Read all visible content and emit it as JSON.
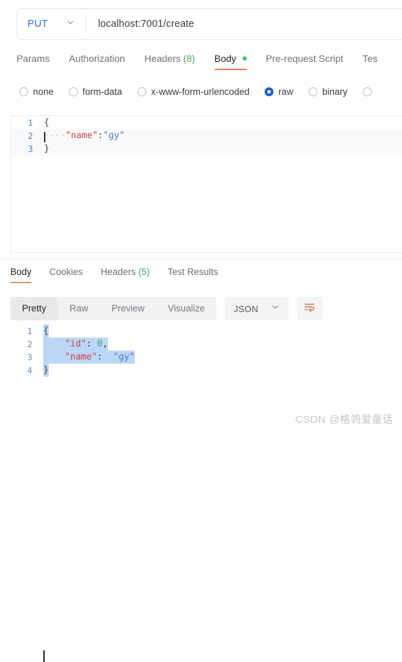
{
  "request": {
    "method": "PUT",
    "method_caret_icon": "chevron-down-icon",
    "url": "localhost:7001/create",
    "url_placeholder": "Enter request URL",
    "tabs": [
      {
        "label": "Params",
        "active": false
      },
      {
        "label": "Authorization",
        "active": false
      },
      {
        "label": "Headers",
        "count": "(8)",
        "active": false
      },
      {
        "label": "Body",
        "active": true,
        "dot": true
      },
      {
        "label": "Pre-request Script",
        "active": false
      },
      {
        "label": "Tes",
        "active": false
      }
    ],
    "body_types": [
      {
        "label": "none",
        "selected": false
      },
      {
        "label": "form-data",
        "selected": false
      },
      {
        "label": "x-www-form-urlencoded",
        "selected": false
      },
      {
        "label": "raw",
        "selected": true
      },
      {
        "label": "binary",
        "selected": false
      },
      {
        "label": "",
        "selected": false
      }
    ],
    "editor": {
      "lines": [
        {
          "number": "1",
          "highlight": false,
          "caret": false,
          "tokens": [
            {
              "text": "{",
              "type": "punc"
            }
          ]
        },
        {
          "number": "2",
          "highlight": true,
          "caret": true,
          "tokens": [
            {
              "text": "····",
              "type": "indent"
            },
            {
              "text": "\"name\"",
              "type": "key"
            },
            {
              "text": ":",
              "type": "punc"
            },
            {
              "text": "\"gy\"",
              "type": "str"
            }
          ]
        },
        {
          "number": "3",
          "highlight": true,
          "caret": false,
          "tokens": [
            {
              "text": "}",
              "type": "punc"
            }
          ]
        }
      ]
    }
  },
  "response": {
    "tabs": [
      {
        "label": "Body",
        "active": true
      },
      {
        "label": "Cookies",
        "active": false
      },
      {
        "label": "Headers",
        "count": "(5)",
        "active": false
      },
      {
        "label": "Test Results",
        "active": false
      }
    ],
    "view_modes": [
      {
        "label": "Pretty",
        "active": true
      },
      {
        "label": "Raw",
        "active": false
      },
      {
        "label": "Preview",
        "active": false
      },
      {
        "label": "Visualize",
        "active": false
      }
    ],
    "format": {
      "label": "JSON",
      "caret_icon": "chevron-down-icon"
    },
    "wrap_button_icon": "word-wrap-icon",
    "body": {
      "selected": true,
      "lines": [
        {
          "number": "1",
          "tokens": [
            {
              "text": "{",
              "type": "punc"
            }
          ]
        },
        {
          "number": "2",
          "tokens": [
            {
              "text": "    ",
              "type": "plain"
            },
            {
              "text": "\"id\"",
              "type": "key"
            },
            {
              "text": ": ",
              "type": "punc"
            },
            {
              "text": "0",
              "type": "num"
            },
            {
              "text": ",",
              "type": "punc"
            }
          ]
        },
        {
          "number": "3",
          "tokens": [
            {
              "text": "    ",
              "type": "plain"
            },
            {
              "text": "\"name\"",
              "type": "key"
            },
            {
              "text": ":  ",
              "type": "punc"
            },
            {
              "text": "\"gy\"",
              "type": "str"
            }
          ]
        },
        {
          "number": "4",
          "tokens": [
            {
              "text": "}",
              "type": "punc"
            }
          ]
        }
      ]
    }
  },
  "watermark": "CSDN @格鸰爱童话",
  "colors": {
    "accent_orange": "#e8804b",
    "method_blue": "#2f6fe4",
    "radio_blue": "#1a5fd4",
    "json_key": "#c5483f",
    "json_string": "#4a7ec0",
    "json_number": "#3f9e6c",
    "selection": "#bcd6f5",
    "dot_green": "#3ec25f",
    "count_green": "#4aa06a"
  }
}
